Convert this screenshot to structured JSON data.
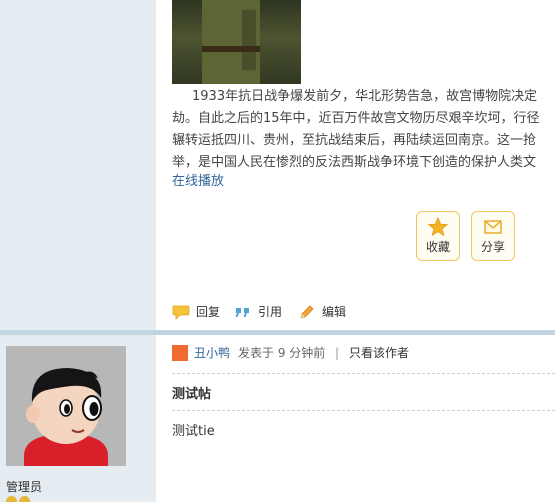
{
  "post": {
    "article_lines": [
      "1933年抗日战争爆发前夕，华北形势告急，故宫博物院决定",
      "劫。自此之后的15年中，近百万件故宫文物历尽艰辛坎坷，行径",
      "辗转运抵四川、贵州，至抗战结束后，再陆续运回南京。这一抢",
      "举，是中国人民在惨烈的反法西斯战争环境下创造的保护人类文"
    ],
    "play_link": "在线播放",
    "actions": {
      "favorite_label": "收藏",
      "share_label": "分享"
    },
    "footer": {
      "reply_label": "回复",
      "quote_label": "引用",
      "edit_label": "编辑"
    }
  },
  "reply": {
    "author": "丑小鸭",
    "posted_at": "发表于 9 分钟前",
    "divider": "|",
    "author_only": "只看该作者",
    "title": "测试帖",
    "body": "测试tie",
    "role": "管理员"
  },
  "colors": {
    "link": "#336699",
    "sidebar_bg": "#e5edf2",
    "separator": "#c2d5e3",
    "button_border": "#f2c660"
  }
}
